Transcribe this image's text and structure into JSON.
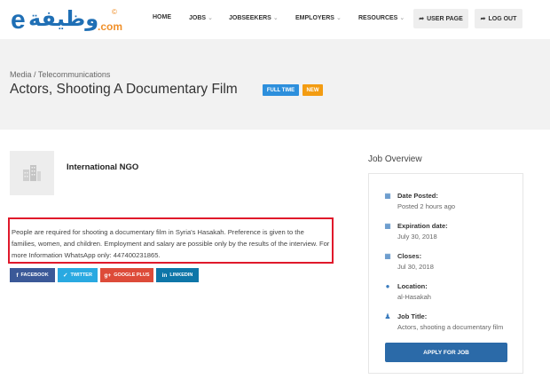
{
  "logo": {
    "latin": "e",
    "arabic": "وظيفة",
    "domain": ".com"
  },
  "nav": [
    {
      "label": "HOME",
      "chevron": ""
    },
    {
      "label": "JOBS",
      "chevron": "⌄"
    },
    {
      "label": "JOBSEEKERS",
      "chevron": "⌄"
    },
    {
      "label": "EMPLOYERS",
      "chevron": "⌄"
    },
    {
      "label": "RESOURCES",
      "chevron": "⌄"
    }
  ],
  "user_page": {
    "label": "USER PAGE",
    "icon": "sign-in-icon"
  },
  "log_out": {
    "label": "LOG OUT",
    "icon": "sign-out-icon"
  },
  "breadcrumb": "Media / Telecommunications",
  "job_title": "Actors, Shooting A Documentary Film",
  "badges": {
    "type": "FULL TIME",
    "new": "NEW"
  },
  "company": {
    "name": "International NGO"
  },
  "description": "People are required for shooting a documentary film in Syria's Hasakah. Preference is given to the families, women, and children. Employment and salary are possible only by the results of the interview. For more Information WhatsApp only: 447400231865.",
  "share": {
    "facebook": "FACEBOOK",
    "twitter": "TWITTER",
    "google": "GOOGLE PLUS",
    "linkedin": "LINKEDIN"
  },
  "overview": {
    "title": "Job Overview",
    "items": [
      {
        "label": "Date Posted:",
        "value": "Posted 2 hours ago",
        "icon": "calendar-icon"
      },
      {
        "label": "Expiration date:",
        "value": "July 30, 2018",
        "icon": "calendar-icon"
      },
      {
        "label": "Closes:",
        "value": "Jul 30, 2018",
        "icon": "calendar-icon"
      },
      {
        "label": "Location:",
        "value": "al-Hasakah",
        "icon": "map-marker-icon"
      },
      {
        "label": "Job Title:",
        "value": "Actors, shooting a documentary film",
        "icon": "user-icon"
      }
    ],
    "apply_label": "APPLY FOR JOB"
  },
  "colors": {
    "brand_blue": "#1f6fb5",
    "brand_orange": "#f0902a",
    "full_time": "#2d8fdc",
    "new": "#f39c12",
    "apply": "#2b6aa8",
    "highlight_border": "#e0192b"
  }
}
